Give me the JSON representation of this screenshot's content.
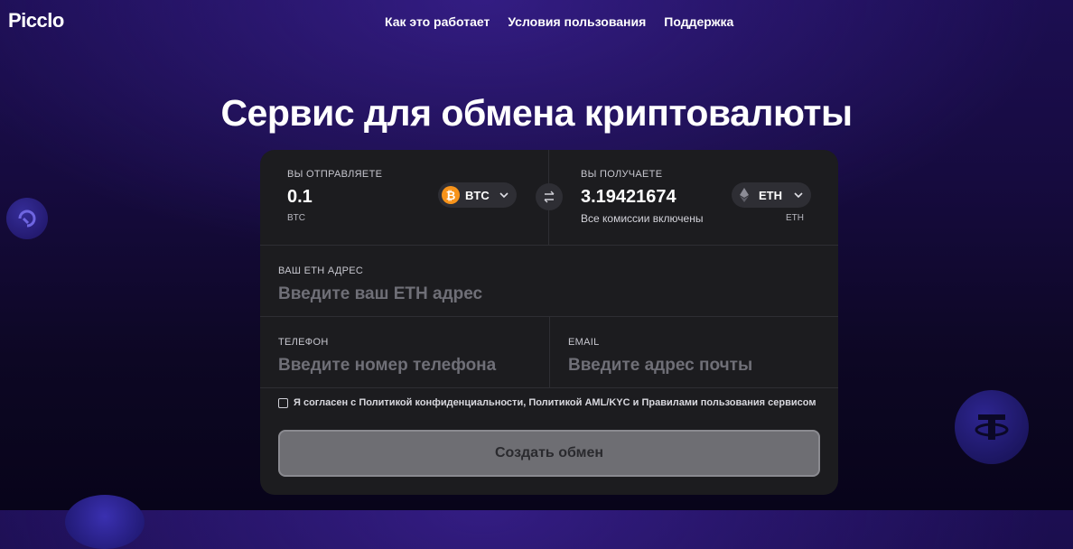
{
  "brand": {
    "logo": "Picclo"
  },
  "nav": [
    {
      "label": "Как это работает"
    },
    {
      "label": "Условия пользования"
    },
    {
      "label": "Поддержка"
    }
  ],
  "hero": {
    "title": "Сервис для обмена криптовалюты"
  },
  "exchange": {
    "send": {
      "label": "ВЫ ОТПРАВЛЯЕТЕ",
      "amount": "0.1",
      "currency_code": "BTC",
      "ticker": "BTC",
      "icon": "bitcoin-icon"
    },
    "receive": {
      "label": "ВЫ ПОЛУЧАЕТЕ",
      "amount": "3.19421674",
      "note": "Все комиссии включены",
      "currency_code": "ETH",
      "ticker": "ETH",
      "icon": "ethereum-icon"
    },
    "swap_icon": "swap-arrows-icon"
  },
  "form": {
    "address": {
      "label": "ВАШ ETH АДРЕС",
      "placeholder": "Введите ваш ETH адрес",
      "value": ""
    },
    "phone": {
      "label": "ТЕЛЕФОН",
      "placeholder": "Введите номер телефона",
      "value": ""
    },
    "email": {
      "label": "EMAIL",
      "placeholder": "Введите адрес почты",
      "value": ""
    },
    "agreement": "Я согласен с Политикой конфиденциальности, Политикой AML/KYC  и Правилами пользования сервисом",
    "submit_label": "Создать обмен"
  },
  "colors": {
    "btc": "#f7931a",
    "card_bg": "#1c1c1f",
    "button_bg": "#6e6e73"
  }
}
